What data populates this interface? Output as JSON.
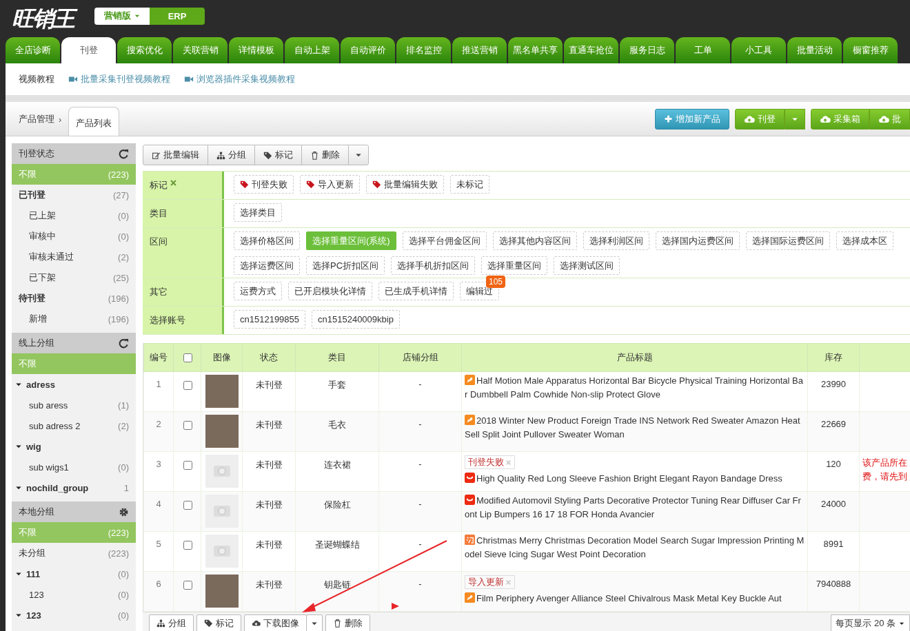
{
  "header": {
    "logo": "旺销王",
    "edition": "营销版",
    "erp": "ERP"
  },
  "nav_tabs": [
    {
      "label": "全店诊断",
      "selected": false
    },
    {
      "label": "刊登",
      "selected": true
    },
    {
      "label": "搜索优化",
      "selected": false
    },
    {
      "label": "关联营销",
      "selected": false
    },
    {
      "label": "详情模板",
      "selected": false
    },
    {
      "label": "自动上架",
      "selected": false
    },
    {
      "label": "自动评价",
      "selected": false
    },
    {
      "label": "排名监控",
      "selected": false
    },
    {
      "label": "推送营销",
      "selected": false
    },
    {
      "label": "黑名单共享",
      "selected": false
    },
    {
      "label": "直通车抢位",
      "selected": false
    },
    {
      "label": "服务日志",
      "selected": false
    },
    {
      "label": "工单",
      "selected": false
    },
    {
      "label": "小工具",
      "selected": false
    },
    {
      "label": "批量活动",
      "selected": false
    },
    {
      "label": "橱窗推荐",
      "selected": false
    }
  ],
  "video_bar": {
    "title": "视频教程",
    "links": [
      "批量采集刊登视频教程",
      "浏览器插件采集视频教程"
    ]
  },
  "breadcrumb": {
    "parent": "产品管理",
    "separator": "›",
    "current": "产品列表"
  },
  "header_buttons": [
    {
      "label": "增加新产品",
      "kind": "add"
    },
    {
      "label": "刊登",
      "kind": "split"
    },
    {
      "label": "采集箱",
      "kind": "group"
    },
    {
      "label": "批",
      "kind": "group"
    }
  ],
  "sidebar": [
    {
      "title": "刊登状态",
      "kind": "refresh",
      "items": [
        {
          "label": "不限",
          "count": "(223)",
          "selected": true
        },
        {
          "label": "已刊登",
          "count": "(27)",
          "selected": false,
          "children": [
            {
              "label": "已上架",
              "count": "(0)",
              "selected": false
            },
            {
              "label": "审核中",
              "count": "(0)",
              "selected": false
            },
            {
              "label": "审核未通过",
              "count": "(2)",
              "selected": false
            },
            {
              "label": "已下架",
              "count": "(25)",
              "selected": false
            }
          ]
        },
        {
          "label": "待刊登",
          "count": "(196)",
          "selected": false,
          "children": [
            {
              "label": "新增",
              "count": "(196)",
              "selected": false
            }
          ]
        }
      ]
    },
    {
      "title": "线上分组",
      "kind": "refresh",
      "items": [
        {
          "label": "不限",
          "selected": true
        },
        {
          "label": "adress",
          "selected": false,
          "expanded": true,
          "children": [
            {
              "label": "sub aress",
              "count": "(1)",
              "selected": false
            },
            {
              "label": "sub adress 2",
              "count": "(2)",
              "selected": false
            }
          ]
        },
        {
          "label": "wig",
          "selected": false,
          "expanded": true,
          "children": [
            {
              "label": "sub wigs1",
              "count": "(0)",
              "selected": false
            }
          ]
        },
        {
          "label": "nochild_group",
          "count": "1",
          "selected": false,
          "expanded": true
        }
      ]
    },
    {
      "title": "本地分组",
      "kind": "gear",
      "items": [
        {
          "label": "不限",
          "count": "(223)",
          "selected": true
        },
        {
          "label": "未分组",
          "count": "(223)",
          "selected": false
        },
        {
          "label": "111",
          "count": "(0)",
          "selected": false,
          "expanded": true,
          "children": [
            {
              "label": "123",
              "count": "(0)",
              "selected": false
            }
          ]
        },
        {
          "label": "123",
          "count": "(0)",
          "selected": false,
          "expanded": true
        }
      ]
    }
  ],
  "toolbar": [
    {
      "label": "批量编辑",
      "kind": "edit"
    },
    {
      "label": "分组",
      "kind": "group"
    },
    {
      "label": "标记",
      "kind": "tag"
    },
    {
      "label": "删除",
      "kind": "trash"
    },
    {
      "kind": "caret"
    }
  ],
  "filters": [
    {
      "label": "标记",
      "clearable": true,
      "chip_lines": [
        [
          {
            "label": "刊登失败",
            "kind": "tag",
            "selected": false
          },
          {
            "label": "导入更新",
            "kind": "tag",
            "selected": false
          },
          {
            "label": "批量编辑失败",
            "kind": "tag",
            "selected": false
          },
          {
            "label": "未标记",
            "kind": "plain",
            "selected": false
          }
        ]
      ]
    },
    {
      "label": "类目",
      "clearable": false,
      "chip_lines": [
        [
          {
            "label": "选择类目",
            "kind": "plain",
            "selected": false
          }
        ]
      ]
    },
    {
      "label": "区间",
      "clearable": false,
      "chip_lines": [
        [
          {
            "label": "选择价格区间",
            "kind": "plain",
            "selected": false
          },
          {
            "label": "选择重量区间(系统)",
            "kind": "plain",
            "selected": true
          },
          {
            "label": "选择平台佣金区间",
            "kind": "plain",
            "selected": false
          },
          {
            "label": "选择其他内容区间",
            "kind": "plain",
            "selected": false
          },
          {
            "label": "选择利润区间",
            "kind": "plain",
            "selected": false
          },
          {
            "label": "选择国内运费区间",
            "kind": "plain",
            "selected": false
          },
          {
            "label": "选择国际运费区间",
            "kind": "plain",
            "selected": false
          },
          {
            "label": "选择成本区",
            "kind": "plain",
            "selected": false
          }
        ],
        [
          {
            "label": "选择运费区间",
            "kind": "plain",
            "selected": false
          },
          {
            "label": "选择PC折扣区间",
            "kind": "plain",
            "selected": false
          },
          {
            "label": "选择手机折扣区间",
            "kind": "plain",
            "selected": false
          },
          {
            "label": "选择重量区间",
            "kind": "plain",
            "selected": false
          },
          {
            "label": "选择测试区间",
            "kind": "plain",
            "selected": false
          }
        ]
      ]
    },
    {
      "label": "其它",
      "clearable": false,
      "chip_lines": [
        [
          {
            "label": "运费方式",
            "kind": "plain",
            "selected": false
          },
          {
            "label": "已开启模块化详情",
            "kind": "plain",
            "selected": false
          },
          {
            "label": "已生成手机详情",
            "kind": "plain",
            "selected": false
          },
          {
            "label": "编辑过",
            "kind": "plain",
            "selected": false,
            "badge": "105"
          }
        ]
      ]
    },
    {
      "label": "选择账号",
      "clearable": false,
      "chip_lines": [
        [
          {
            "label": "cn1512199855",
            "kind": "plain",
            "selected": false
          },
          {
            "label": "cn1515240009kbip",
            "kind": "plain",
            "selected": false
          }
        ]
      ]
    }
  ],
  "table": {
    "columns": [
      {
        "label": "编号",
        "kind": "text"
      },
      {
        "kind": "checkbox",
        "checked": false
      },
      {
        "label": "图像",
        "kind": "text"
      },
      {
        "label": "状态",
        "kind": "text"
      },
      {
        "label": "类目",
        "kind": "text"
      },
      {
        "label": "店铺分组",
        "kind": "text"
      },
      {
        "label": "产品标题",
        "kind": "text"
      },
      {
        "label": "库存",
        "kind": "text"
      },
      {
        "kind": "blank"
      }
    ],
    "rows": [
      {
        "no": "1",
        "checked": false,
        "has_image": true,
        "status": "未刊登",
        "category": "手套",
        "shop_group": "-",
        "title": "Half Motion Male Apparatus Horizontal Bar Bicycle Physical Training Horizontal Bar Dumbbell Palm Cowhide Non-slip Protect Glove",
        "stock": "23990"
      },
      {
        "no": "2",
        "checked": false,
        "has_image": true,
        "status": "未刊登",
        "category": "毛衣",
        "shop_group": "-",
        "title": "2018 Winter New Product Foreign Trade INS Network Red Sweater Amazon Heat Sell Split Joint Pullover Sweater Woman",
        "stock": "22669"
      },
      {
        "no": "3",
        "checked": false,
        "has_image": false,
        "status": "未刊登",
        "category": "连衣裙",
        "shop_group": "-",
        "tag": "刊登失败",
        "title": "High Quality Red Long Sleeve Fashion Bright Elegant Rayon Bandage Dress",
        "stock": "120",
        "note": "该产品所在费，请先到"
      },
      {
        "no": "4",
        "checked": false,
        "has_image": false,
        "status": "未刊登",
        "category": "保险杠",
        "shop_group": "-",
        "title": "Modified Automovil Styling Parts Decorative Protector Tuning Rear Diffuser Car Front Lip Bumpers 16 17 18 FOR Honda Avancier",
        "stock": "24000"
      },
      {
        "no": "5",
        "checked": false,
        "has_image": false,
        "status": "未刊登",
        "category": "圣诞蝴蝶结",
        "shop_group": "-",
        "title": "Christmas Merry Christmas Decoration Model Search Sugar Impression Printing Model Sieve Icing Sugar West Point Decoration",
        "stock": "8991"
      },
      {
        "no": "6",
        "checked": false,
        "has_image": true,
        "status": "未刊登",
        "category": "钥匙链",
        "shop_group": "-",
        "tag": "导入更新",
        "title": "Film Periphery Avenger Alliance Steel Chivalrous Mask Metal Key Buckle Aut",
        "stock": "7940888"
      }
    ]
  },
  "footer": {
    "buttons": [
      {
        "label": "分组",
        "kind": "group"
      },
      {
        "label": "标记",
        "kind": "tag"
      },
      {
        "label": "下载图像",
        "kind": "download"
      },
      {
        "kind": "caret"
      },
      {
        "label": "删除",
        "kind": "trash"
      }
    ],
    "page_size": "每页显示 20 条"
  }
}
